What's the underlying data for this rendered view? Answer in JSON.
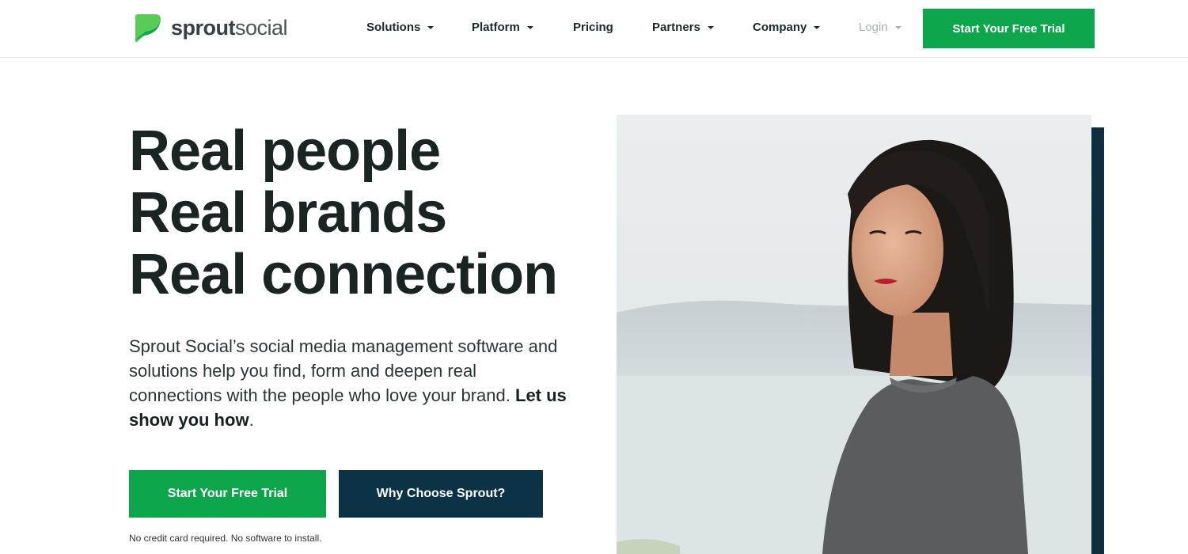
{
  "brand": {
    "name_bold": "sprout",
    "name_light": "social",
    "logo_icon": "sprout-leaf-icon",
    "green": "#0ea64d",
    "navy": "#0c3245"
  },
  "nav": {
    "items": [
      {
        "label": "Solutions",
        "dropdown": true
      },
      {
        "label": "Platform",
        "dropdown": true
      },
      {
        "label": "Pricing",
        "dropdown": false
      },
      {
        "label": "Partners",
        "dropdown": true
      },
      {
        "label": "Company",
        "dropdown": true
      }
    ],
    "login_label": "Login",
    "cta_label": "Start Your Free Trial"
  },
  "hero": {
    "headline": [
      "Real people",
      "Real brands",
      "Real connection"
    ],
    "description": "Sprout Social’s social media management software and solutions help you find, form and deepen real connections with the people who love your brand.",
    "description_strong": "Let us show you how",
    "description_end": ".",
    "primary_button": "Start Your Free Trial",
    "secondary_button": "Why Choose Sprout?",
    "fineprint": "No credit card required. No software to install."
  }
}
